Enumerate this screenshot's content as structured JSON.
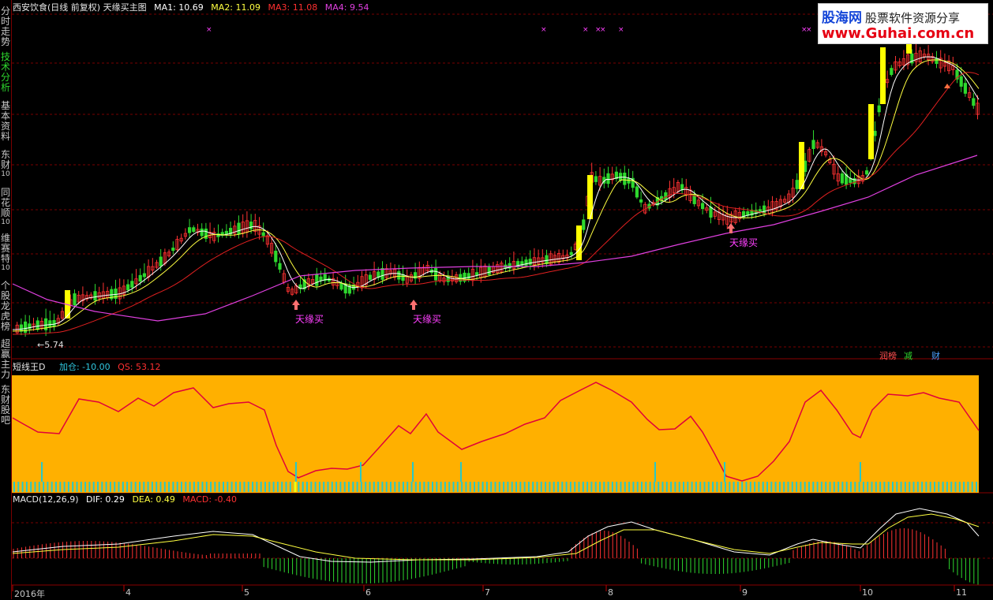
{
  "sidebar": {
    "tabs": [
      {
        "label": "分时走势",
        "num": ""
      },
      {
        "label": "技术分析",
        "num": ""
      },
      {
        "label": "基本资料",
        "num": ""
      },
      {
        "label": "东财",
        "num": "10"
      },
      {
        "label": "同花顺",
        "num": "10"
      },
      {
        "label": "维赛特",
        "num": "10"
      },
      {
        "label": "个股龙虎榜",
        "num": ""
      },
      {
        "label": "超赢主力",
        "num": ""
      },
      {
        "label": "东财股吧",
        "num": ""
      }
    ]
  },
  "main_header": {
    "title": "西安饮食(日线 前复权) 天缘买主图",
    "ma1": "MA1: 10.69",
    "ma2": "MA2: 11.09",
    "ma3": "MA3: 11.08",
    "ma4": "MA4: 9.54"
  },
  "logo": {
    "name": "股海网",
    "slogan": "股票软件资源分享",
    "url": "www.Guhai.com.cn"
  },
  "signals": {
    "buy_label": "天缘买",
    "low_label": "5.74"
  },
  "bottom_tags": {
    "tag1": "润榜",
    "tag2": "减",
    "tag3": "财"
  },
  "indicator": {
    "name": "短线王D",
    "jiacang": "加仓: -10.00",
    "qs": "QS: 53.12"
  },
  "macd": {
    "name": "MACD(12,26,9)",
    "dif": "DIF: 0.29",
    "dea": "DEA: 0.49",
    "macd": "MACD: -0.40"
  },
  "x_axis": {
    "labels": [
      "2016年",
      "4",
      "5",
      "6",
      "7",
      "8",
      "9",
      "10",
      "11"
    ]
  },
  "colors": {
    "up": "#ff3232",
    "down": "#2ed82e",
    "ma1": "#ffffff",
    "ma2": "#ffff40",
    "ma3": "#e02020",
    "ma4": "#e040e0",
    "panel_bg": "#ffb000",
    "qs_line": "#e0003a",
    "bars": "#28c8c8",
    "macd_dif": "#ffffff",
    "macd_dea": "#ffff40"
  }
}
